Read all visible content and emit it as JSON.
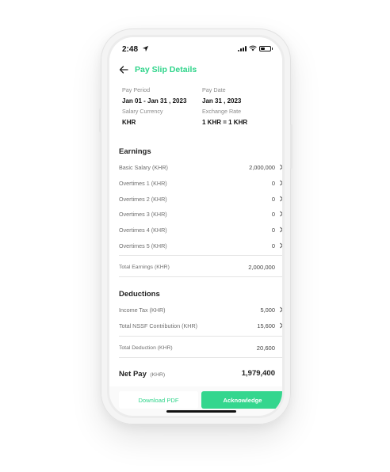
{
  "status_bar": {
    "time": "2:48"
  },
  "header": {
    "title": "Pay Slip Details"
  },
  "meta": {
    "pay_period_label": "Pay Period",
    "pay_period_value": "Jan 01 - Jan 31 , 2023",
    "pay_date_label": "Pay Date",
    "pay_date_value": "Jan 31 , 2023",
    "salary_currency_label": "Salary Currency",
    "salary_currency_value": "KHR",
    "exchange_rate_label": "Exchange Rate",
    "exchange_rate_value": "1 KHR = 1 KHR"
  },
  "earnings": {
    "title": "Earnings",
    "items": [
      {
        "label": "Basic Salary (KHR)",
        "value": "2,000,000"
      },
      {
        "label": "Overtimes 1 (KHR)",
        "value": "0"
      },
      {
        "label": "Overtimes 2 (KHR)",
        "value": "0"
      },
      {
        "label": "Overtimes 3 (KHR)",
        "value": "0"
      },
      {
        "label": "Overtimes 4 (KHR)",
        "value": "0"
      },
      {
        "label": "Overtimes 5 (KHR)",
        "value": "0"
      }
    ],
    "total_label": "Total Earnings (KHR)",
    "total_value": "2,000,000"
  },
  "deductions": {
    "title": "Deductions",
    "items": [
      {
        "label": "Income Tax (KHR)",
        "value": "5,000"
      },
      {
        "label": "Total NSSF Contribution (KHR)",
        "value": "15,600"
      }
    ],
    "total_label": "Total Deduction (KHR)",
    "total_value": "20,600"
  },
  "net_pay": {
    "label": "Net Pay",
    "unit": "(KHR)",
    "value": "1,979,400"
  },
  "footer": {
    "download_label": "Download PDF",
    "acknowledge_label": "Acknowledge"
  },
  "colors": {
    "accent": "#2ed48a",
    "button": "#34d68e"
  },
  "icons": [
    "location-arrow-icon",
    "signal-icon",
    "wifi-icon",
    "battery-icon",
    "back-arrow-icon",
    "chevron-right-icon"
  ]
}
